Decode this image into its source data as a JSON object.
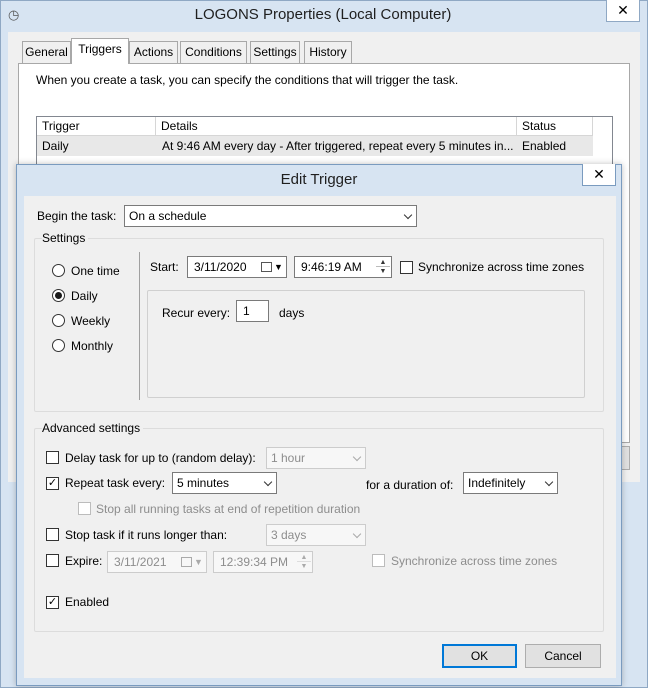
{
  "properties_window": {
    "title": "LOGONS Properties (Local Computer)",
    "close_label": "✕",
    "tabs": [
      "General",
      "Triggers",
      "Actions",
      "Conditions",
      "Settings",
      "History"
    ],
    "active_tab": "Triggers",
    "description": "When you create a task, you can specify the conditions that will trigger the task.",
    "table": {
      "columns": [
        "Trigger",
        "Details",
        "Status"
      ],
      "rows": [
        {
          "trigger": "Daily",
          "details": "At 9:46 AM every day - After triggered, repeat every 5 minutes in...",
          "status": "Enabled"
        }
      ]
    }
  },
  "dialog": {
    "title": "Edit Trigger",
    "close_label": "✕",
    "begin_task": {
      "label": "Begin the task:",
      "value": "On a schedule"
    },
    "settings": {
      "group_label": "Settings",
      "options": [
        "One time",
        "Daily",
        "Weekly",
        "Monthly"
      ],
      "selected": "Daily",
      "start_label": "Start:",
      "start_date": "3/11/2020",
      "start_time": "9:46:19 AM",
      "sync_label": "Synchronize across time zones",
      "recur_label": "Recur every:",
      "recur_value": "1",
      "recur_unit": "days"
    },
    "advanced": {
      "group_label": "Advanced settings",
      "delay_label": "Delay task for up to (random delay):",
      "delay_value": "1 hour",
      "repeat_label": "Repeat task every:",
      "repeat_value": "5 minutes",
      "duration_label": "for a duration of:",
      "duration_value": "Indefinitely",
      "stop_all_label": "Stop all running tasks at end of repetition duration",
      "stop_task_label": "Stop task if it runs longer than:",
      "stop_task_value": "3 days",
      "expire_label": "Expire:",
      "expire_date": "3/11/2021",
      "expire_time": "12:39:34 PM",
      "expire_sync_label": "Synchronize across time zones",
      "enabled_label": "Enabled"
    },
    "ok_label": "OK",
    "cancel_label": "Cancel"
  }
}
